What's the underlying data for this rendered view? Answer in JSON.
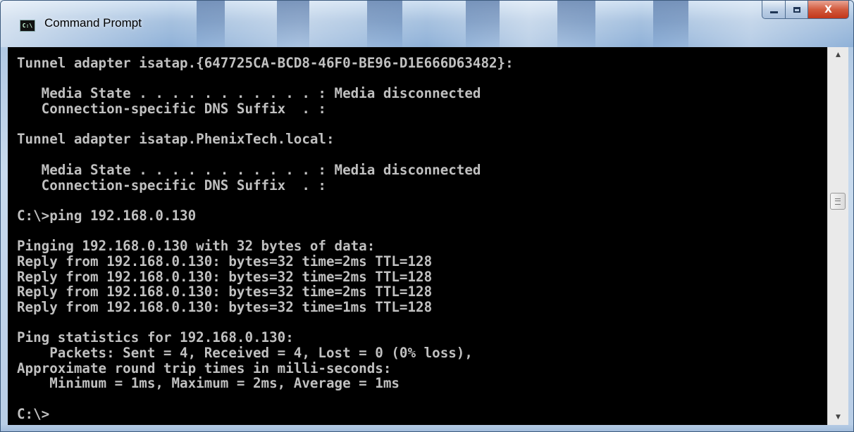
{
  "window": {
    "title": "Command Prompt",
    "icon_label": "C:\\",
    "controls": {
      "minimize": "minimize-icon",
      "maximize": "maximize-icon",
      "close_label": "X"
    }
  },
  "console": {
    "lines": [
      "Tunnel adapter isatap.{647725CA-BCD8-46F0-BE96-D1E666D63482}:",
      "",
      "   Media State . . . . . . . . . . . : Media disconnected",
      "   Connection-specific DNS Suffix  . :",
      "",
      "Tunnel adapter isatap.PhenixTech.local:",
      "",
      "   Media State . . . . . . . . . . . : Media disconnected",
      "   Connection-specific DNS Suffix  . :",
      "",
      "C:\\>ping 192.168.0.130",
      "",
      "Pinging 192.168.0.130 with 32 bytes of data:",
      "Reply from 192.168.0.130: bytes=32 time=2ms TTL=128",
      "Reply from 192.168.0.130: bytes=32 time=2ms TTL=128",
      "Reply from 192.168.0.130: bytes=32 time=2ms TTL=128",
      "Reply from 192.168.0.130: bytes=32 time=1ms TTL=128",
      "",
      "Ping statistics for 192.168.0.130:",
      "    Packets: Sent = 4, Received = 4, Lost = 0 (0% loss),",
      "Approximate round trip times in milli-seconds:",
      "    Minimum = 1ms, Maximum = 2ms, Average = 1ms",
      "",
      "C:\\>"
    ]
  },
  "scrollbar": {
    "up_arrow": "▲",
    "down_arrow": "▼"
  },
  "colors": {
    "console_bg": "#000000",
    "console_text": "#c0c0c0",
    "close_button": "#c2361a"
  }
}
